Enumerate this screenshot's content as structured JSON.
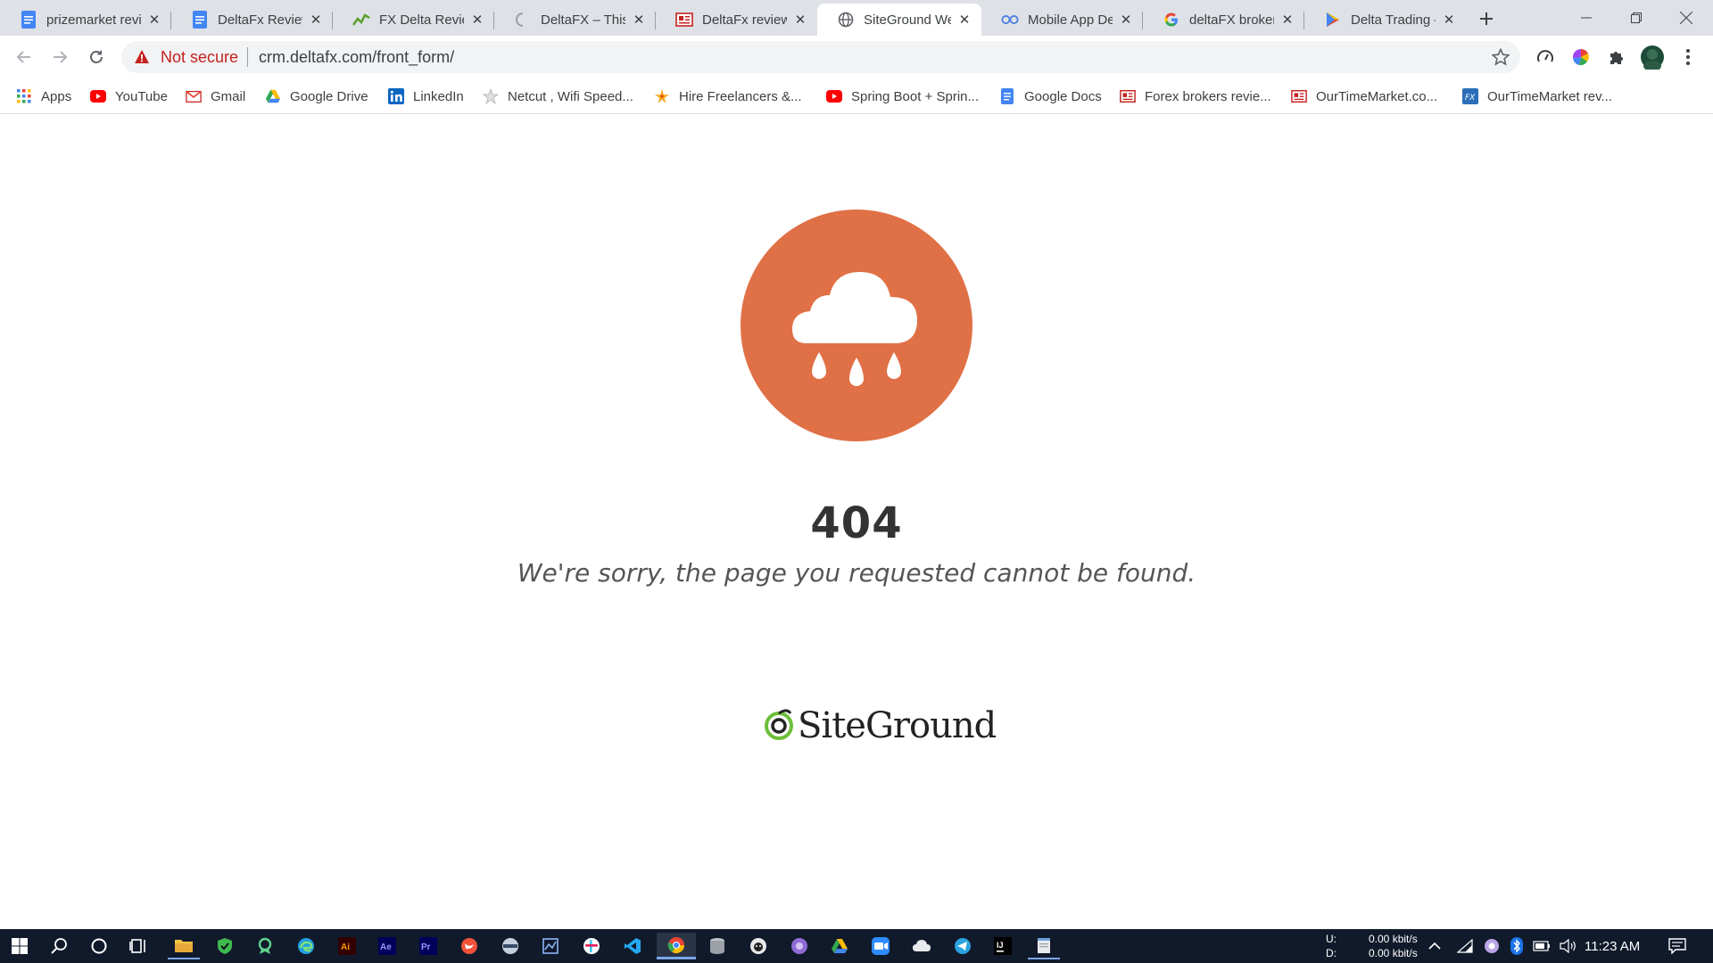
{
  "tabs": [
    {
      "title": "prizemarket review",
      "icon": "docs-icon"
    },
    {
      "title": "DeltaFx Review",
      "icon": "docs-icon"
    },
    {
      "title": "FX Delta Review",
      "icon": "chart-icon"
    },
    {
      "title": "DeltaFX – This",
      "icon": "loading-icon"
    },
    {
      "title": "DeltaFx review",
      "icon": "news-icon"
    },
    {
      "title": "SiteGround We",
      "icon": "globe-icon"
    },
    {
      "title": "Mobile App De",
      "icon": "infinity-icon"
    },
    {
      "title": "deltaFX broker",
      "icon": "google-icon"
    },
    {
      "title": "Delta Trading –",
      "icon": "play-store-icon"
    }
  ],
  "toolbar": {
    "security_label": "Not secure",
    "url": "crm.deltafx.com/front_form/"
  },
  "bookmarks": [
    {
      "label": "Apps",
      "icon": "apps-grid-icon"
    },
    {
      "label": "YouTube",
      "icon": "youtube-icon"
    },
    {
      "label": "Gmail",
      "icon": "gmail-icon"
    },
    {
      "label": "Google Drive",
      "icon": "drive-icon"
    },
    {
      "label": "LinkedIn",
      "icon": "linkedin-icon"
    },
    {
      "label": "Netcut , Wifi Speed...",
      "icon": "netcut-icon"
    },
    {
      "label": "Hire Freelancers &...",
      "icon": "freelancer-icon"
    },
    {
      "label": "Spring Boot + Sprin...",
      "icon": "youtube-icon"
    },
    {
      "label": "Google Docs",
      "icon": "docs-icon"
    },
    {
      "label": "Forex brokers revie...",
      "icon": "news-icon"
    },
    {
      "label": "OurTimeMarket.co...",
      "icon": "news-icon"
    },
    {
      "label": "OurTimeMarket rev...",
      "icon": "fx-icon"
    }
  ],
  "page": {
    "code": "404",
    "message": "We're sorry, the page you requested cannot be found.",
    "brand": "SiteGround",
    "accent_color": "#e07046"
  },
  "taskbar": {
    "upload_label": "U:",
    "download_label": "D:",
    "upload_rate": "0.00 kbit/s",
    "download_rate": "0.00 kbit/s",
    "time": "11:23 AM"
  }
}
